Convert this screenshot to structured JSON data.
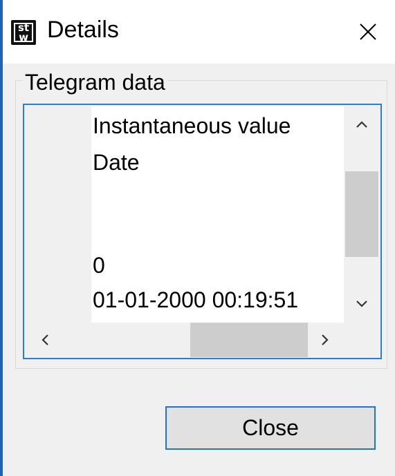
{
  "window": {
    "title": "Details",
    "icon": "stw-app-icon",
    "icon_text_top": "st",
    "icon_text_bottom": "w"
  },
  "group": {
    "label": "Telegram data"
  },
  "listbox": {
    "rows": [
      "Instantaneous value",
      "Date",
      "0",
      "01-01-2000  00:19:51"
    ]
  },
  "buttons": {
    "close_label": "Close"
  },
  "colors": {
    "accent_border": "#1f74d0",
    "window_border": "#1e63b8",
    "scroll_thumb": "#cdcdcd"
  }
}
